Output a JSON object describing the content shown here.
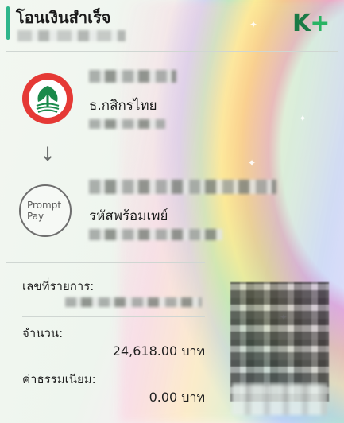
{
  "header": {
    "title": "โอนเงินสำเร็จ",
    "app_logo_main": "K",
    "app_logo_plus": "+"
  },
  "sender": {
    "bank_name": "ธ.กสิกรไทย",
    "logo_icon": "kasikorn-bank-icon"
  },
  "transfer_arrow": "↓",
  "receiver": {
    "logo_line1": "Prompt",
    "logo_line2": "Pay",
    "bank_name": "รหัสพร้อมเพย์"
  },
  "details": {
    "reference_label": "เลขที่รายการ:",
    "amount_label": "จำนวน:",
    "amount_value": "24,618.00 บาท",
    "fee_label": "ค่าธรรมเนียม:",
    "fee_value": "0.00 บาท"
  },
  "colors": {
    "accent": "#2fb58b",
    "brand_green": "#1a7a45",
    "bank_red": "#e53935"
  }
}
